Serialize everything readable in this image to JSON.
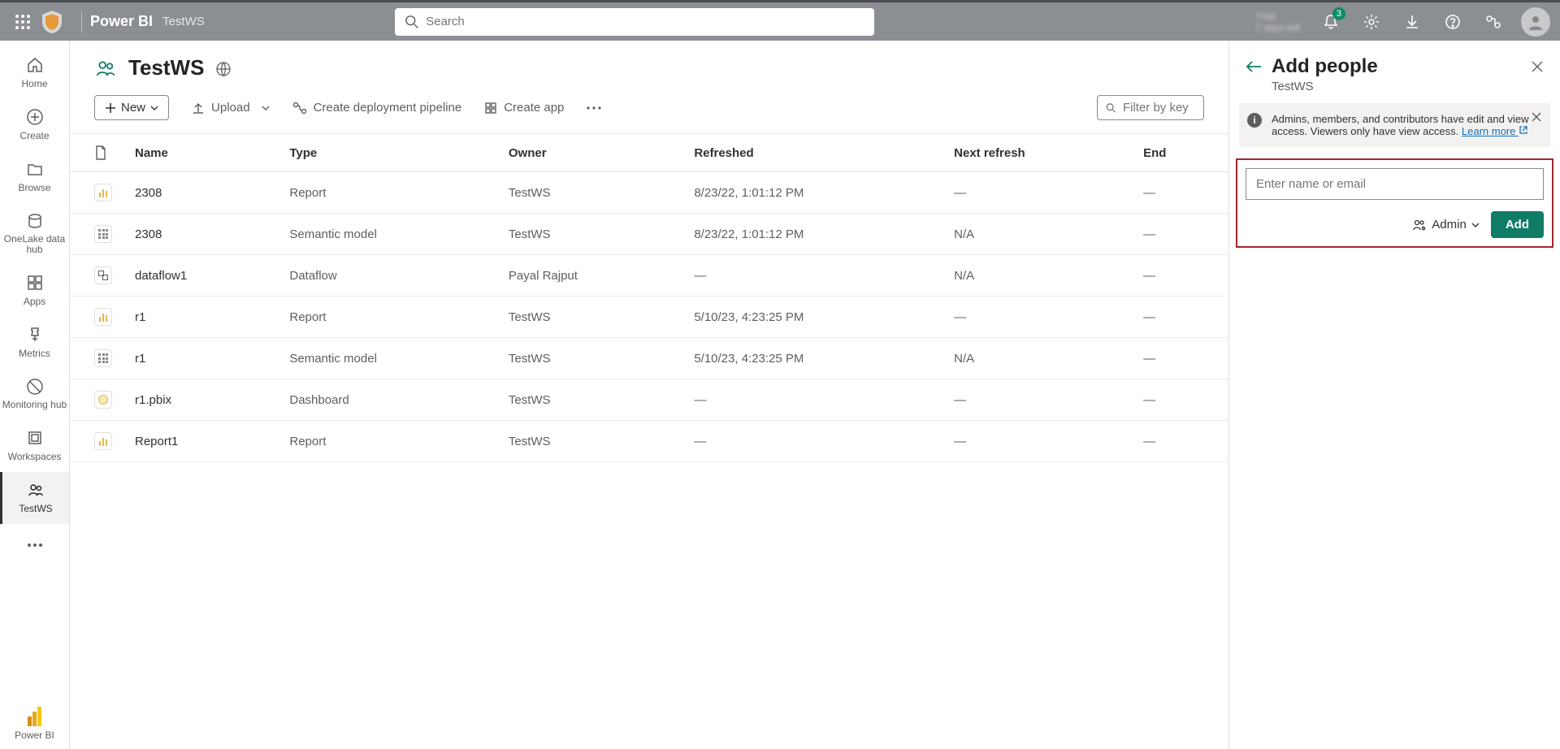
{
  "header": {
    "app_name": "Power BI",
    "workspace": "TestWS",
    "search_placeholder": "Search",
    "notification_count": "3",
    "trial_line1": "Trial:",
    "trial_line2": "7 days left"
  },
  "leftnav": {
    "home": "Home",
    "create": "Create",
    "browse": "Browse",
    "onelake": "OneLake data hub",
    "apps": "Apps",
    "metrics": "Metrics",
    "monitoring": "Monitoring hub",
    "workspaces": "Workspaces",
    "testws": "TestWS",
    "bottom": "Power BI"
  },
  "main": {
    "title": "TestWS",
    "toolbar": {
      "new": "New",
      "upload": "Upload",
      "pipeline": "Create deployment pipeline",
      "createapp": "Create app",
      "filter_placeholder": "Filter by key"
    },
    "columns": {
      "name": "Name",
      "type": "Type",
      "owner": "Owner",
      "refreshed": "Refreshed",
      "next": "Next refresh",
      "end": "End"
    },
    "rows": [
      {
        "icon": "report",
        "name": "2308",
        "type": "Report",
        "owner": "TestWS",
        "refreshed": "8/23/22, 1:01:12 PM",
        "next": "—",
        "end": "—"
      },
      {
        "icon": "dataset",
        "name": "2308",
        "type": "Semantic model",
        "owner": "TestWS",
        "refreshed": "8/23/22, 1:01:12 PM",
        "next": "N/A",
        "end": "—"
      },
      {
        "icon": "dataflow",
        "name": "dataflow1",
        "type": "Dataflow",
        "owner": "Payal Rajput",
        "refreshed": "—",
        "next": "N/A",
        "end": "—"
      },
      {
        "icon": "report",
        "name": "r1",
        "type": "Report",
        "owner": "TestWS",
        "refreshed": "5/10/23, 4:23:25 PM",
        "next": "—",
        "end": "—"
      },
      {
        "icon": "dataset",
        "name": "r1",
        "type": "Semantic model",
        "owner": "TestWS",
        "refreshed": "5/10/23, 4:23:25 PM",
        "next": "N/A",
        "end": "—"
      },
      {
        "icon": "dashboard",
        "name": "r1.pbix",
        "type": "Dashboard",
        "owner": "TestWS",
        "refreshed": "—",
        "next": "—",
        "end": "—"
      },
      {
        "icon": "report",
        "name": "Report1",
        "type": "Report",
        "owner": "TestWS",
        "refreshed": "—",
        "next": "—",
        "end": "—"
      }
    ]
  },
  "panel": {
    "title": "Add people",
    "subtitle": "TestWS",
    "info_text": "Admins, members, and contributors have edit and view access. Viewers only have view access. ",
    "learn_more": "Learn more",
    "input_placeholder": "Enter name or email",
    "role_label": "Admin",
    "add_label": "Add"
  }
}
